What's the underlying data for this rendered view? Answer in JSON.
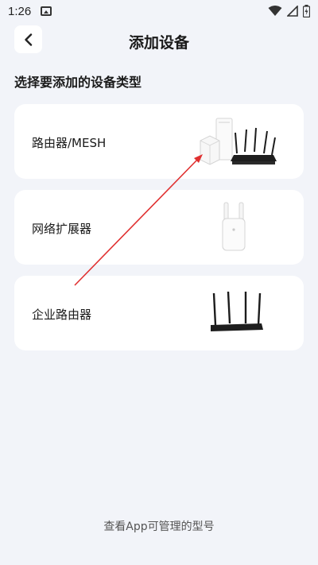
{
  "status_bar": {
    "time": "1:26",
    "icons": [
      "image-icon",
      "wifi-icon",
      "signal-icon",
      "battery-icon"
    ]
  },
  "header": {
    "title": "添加设备",
    "back_icon": "chevron-left-icon"
  },
  "section": {
    "title": "选择要添加的设备类型"
  },
  "devices": [
    {
      "label": "路由器/MESH",
      "image": "router-mesh-image"
    },
    {
      "label": "网络扩展器",
      "image": "extender-image"
    },
    {
      "label": "企业路由器",
      "image": "enterprise-router-image"
    }
  ],
  "footer": {
    "link": "查看App可管理的型号"
  },
  "colors": {
    "background": "#f2f4f9",
    "card": "#ffffff",
    "annotation_arrow": "#e03030"
  }
}
